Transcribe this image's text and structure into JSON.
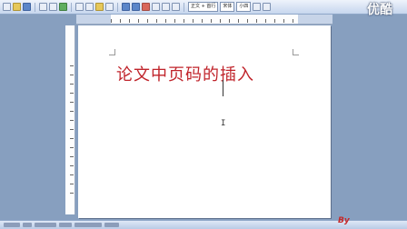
{
  "app": {
    "watermark_text": "优酷"
  },
  "toolbar": {
    "style_value": "正文 + 首行",
    "font_value": "宋体",
    "size_value": "小四"
  },
  "document": {
    "title": "论文中页码的插入"
  },
  "status_bar": {
    "byline": "By"
  },
  "colors": {
    "title": "#c0242b",
    "workspace": "#879fbf"
  }
}
